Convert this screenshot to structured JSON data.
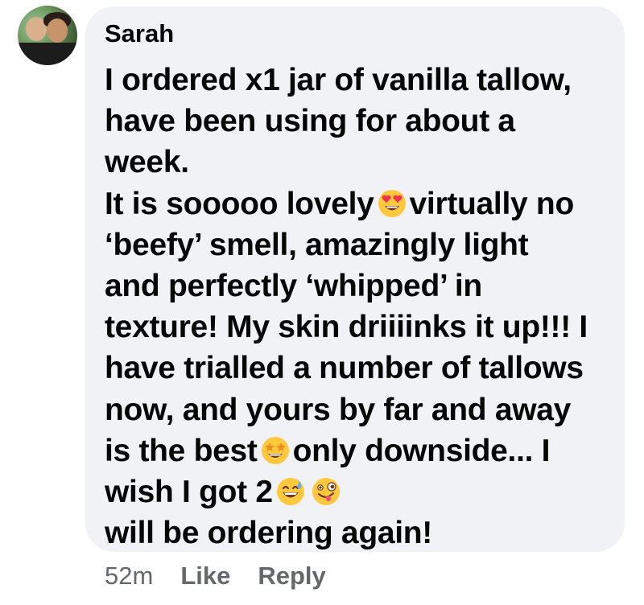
{
  "comment": {
    "author": "Sarah",
    "lines": [
      "I ordered x1 jar of vanilla tallow,",
      "have been using for about a",
      "week.",
      "It is sooooo lovely",
      "virtually no",
      "‘beefy’ smell, amazingly light",
      "and perfectly ‘whipped’ in",
      "texture! My skin driiiinks it up!!! I",
      "have trialled a number of tallows",
      "now, and yours by far and away",
      "is the best",
      "only downside... I",
      "wish I got 2",
      "will be ordering again!"
    ],
    "emoji_icons": [
      "heart-eyes-emoji-icon",
      "star-struck-emoji-icon",
      "sweat-smile-emoji-icon",
      "zany-face-emoji-icon"
    ]
  },
  "actions": {
    "timestamp": "52m",
    "like_label": "Like",
    "reply_label": "Reply"
  },
  "colors": {
    "bubble": "#f0f2f5",
    "text": "#050505",
    "secondary": "#65676b",
    "emoji_yellow": "#ffc83d",
    "heart_red": "#f0324b"
  }
}
